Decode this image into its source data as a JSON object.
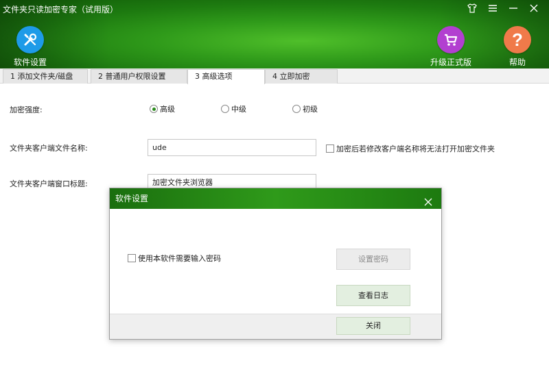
{
  "app": {
    "title": "文件夹只读加密专家（试用版）"
  },
  "toolbar": {
    "settings_label": "软件设置",
    "upgrade_label": "升级正式版",
    "help_label": "帮助",
    "help_symbol": "?"
  },
  "tabs": [
    {
      "label": "1 添加文件夹/磁盘"
    },
    {
      "label": "2 普通用户权限设置"
    },
    {
      "label": "3 高级选项",
      "active": true
    },
    {
      "label": "4 立即加密"
    }
  ],
  "form": {
    "strength_label": "加密强度:",
    "strength_options": [
      {
        "label": "高级",
        "checked": true
      },
      {
        "label": "中级",
        "checked": false
      },
      {
        "label": "初级",
        "checked": false
      }
    ],
    "client_filename_label": "文件夹客户端文件名称:",
    "client_filename_value": "ude",
    "rename_warning": "加密后若修改客户端名称将无法打开加密文件夹",
    "window_title_label": "文件夹客户端窗口标题:",
    "window_title_value": "加密文件夹浏览器"
  },
  "dialog": {
    "title": "软件设置",
    "require_password_label": "使用本软件需要输入密码",
    "set_password_button": "设置密码",
    "view_log_button": "查看日志",
    "close_button": "关闭"
  },
  "colors": {
    "header_green": "#2f9a1a",
    "settings_blue": "#1e9be8",
    "upgrade_purple": "#b23fd0",
    "help_orange": "#f07a4a"
  }
}
